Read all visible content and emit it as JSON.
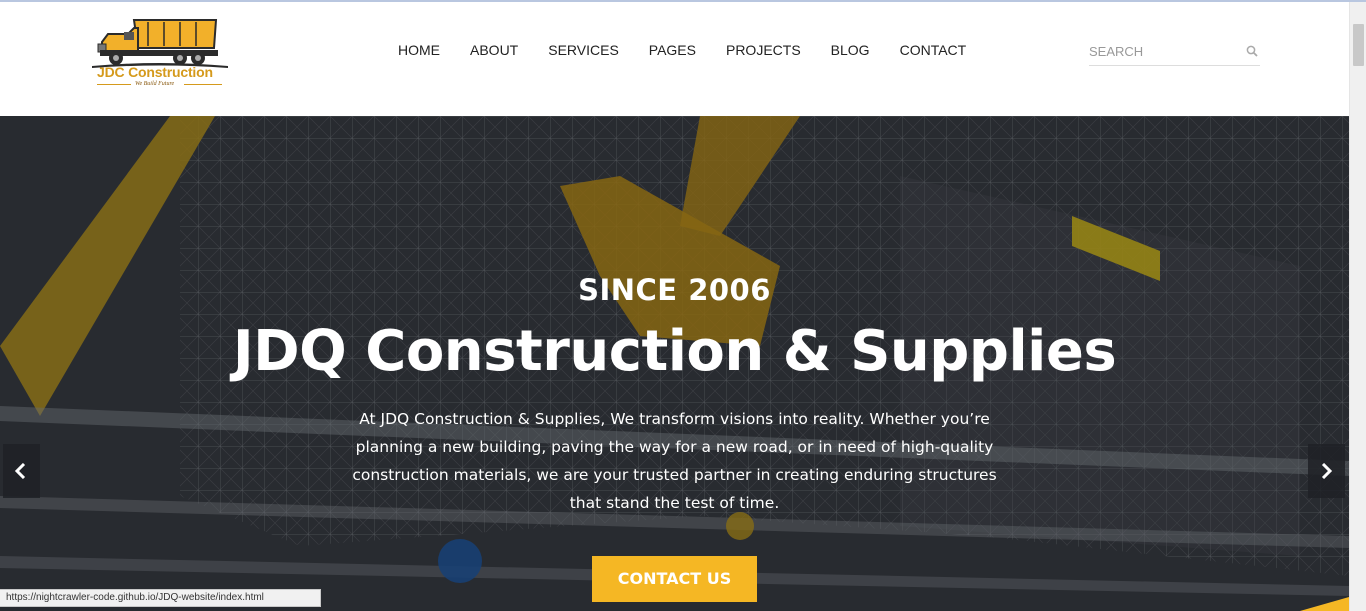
{
  "brand": {
    "name": "JDC Construction",
    "tagline": "We Build Future"
  },
  "nav": {
    "items": [
      {
        "label": "HOME"
      },
      {
        "label": "ABOUT"
      },
      {
        "label": "SERVICES"
      },
      {
        "label": "PAGES"
      },
      {
        "label": "PROJECTS"
      },
      {
        "label": "BLOG"
      },
      {
        "label": "CONTACT"
      }
    ]
  },
  "search": {
    "placeholder": "SEARCH",
    "value": "",
    "icon": "search-icon"
  },
  "hero": {
    "kicker": "SINCE 2006",
    "title": "JDQ Construction & Supplies",
    "description": "At JDQ Construction & Supplies, We transform visions into reality. Whether you’re planning a new building, paving the way for a new road, or in need of high-quality construction materials, we are your trusted partner in creating enduring structures that stand the test of time.",
    "cta_label": "CONTACT US",
    "prev_icon": "chevron-left-icon",
    "next_icon": "chevron-right-icon"
  },
  "status": {
    "url": "https://nightcrawler-code.github.io/JDQ-website/index.html"
  },
  "colors": {
    "accent": "#f5b724",
    "nav_text": "#222222",
    "logo_gold": "#d59a1c"
  }
}
